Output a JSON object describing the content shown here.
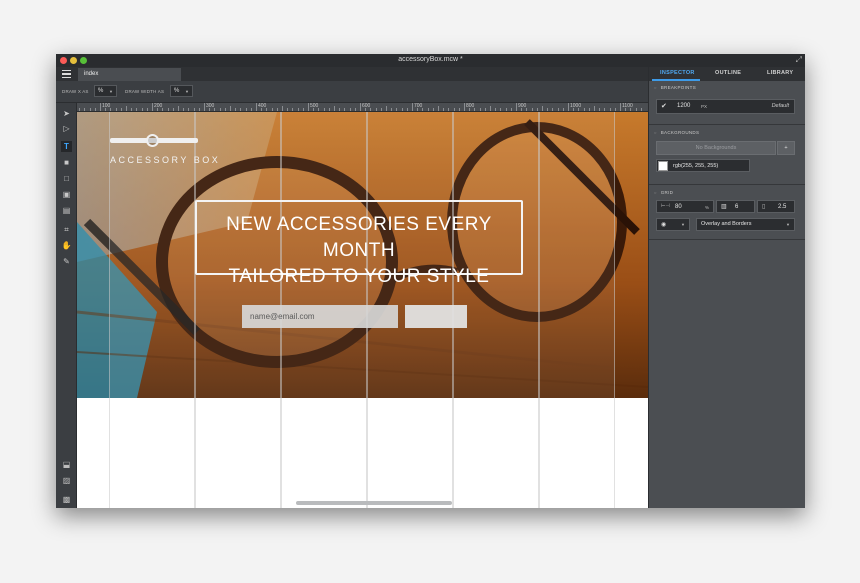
{
  "window": {
    "title": "accessoryBox.mcw *"
  },
  "tabs": [
    {
      "label": "index"
    }
  ],
  "toolbar": {
    "draw_x_label": "DRAW X AS",
    "draw_x_value": "%",
    "draw_width_label": "DRAW WIDTH AS",
    "draw_width_value": "%"
  },
  "ruler": {
    "labels": [
      "100",
      "200",
      "300",
      "400",
      "500",
      "600",
      "700",
      "800",
      "900",
      "1000",
      "1100"
    ]
  },
  "canvas": {
    "logo_text": "ACCESSORY BOX",
    "headline_line1": "NEW ACCESSORIES EVERY MONTH",
    "headline_line2": "TAILORED TO YOUR STYLE",
    "email_placeholder": "name@email.com",
    "submit_label": ""
  },
  "panel": {
    "tabs": {
      "inspector": "INSPECTOR",
      "outline": "OUTLINE",
      "library": "LIBRARY"
    },
    "breakpoints": {
      "title": "BREAKPOINTS",
      "value": "1200",
      "unit": "PX",
      "label": "Default"
    },
    "backgrounds": {
      "title": "BACKGROUNDS",
      "placeholder": "No Backgrounds",
      "add": "+",
      "color": "rgb(255, 255, 255)"
    },
    "grid": {
      "title": "GRID",
      "width": "80",
      "width_unit": "%",
      "columns": "6",
      "gutter": "2.5",
      "display": "Overlay and Borders"
    }
  },
  "colors": {
    "accent": "#3e9be8",
    "panel": "#4b4e52",
    "chrome": "#2f3134"
  }
}
